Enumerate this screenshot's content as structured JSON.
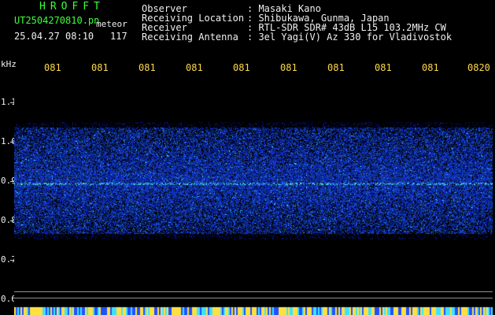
{
  "header": {
    "app_title": "HROFFT",
    "file_name": "UT2504270810.pn",
    "file_tag": "meteor",
    "date_time": "25.04.27 08:10",
    "count": "117"
  },
  "info": [
    {
      "label": "Observer",
      "value": ": Masaki Kano"
    },
    {
      "label": "Receiving Location",
      "value": ": Shibukawa, Gunma, Japan"
    },
    {
      "label": "Receiver",
      "value": ": RTL-SDR SDR# 43dB L15 103.2MHz CW"
    },
    {
      "label": "Receiving Antenna",
      "value": ": 3el Yagi(V) Az 330 for Vladivostok"
    }
  ],
  "axis": {
    "y_unit": "kHz",
    "y_ticks": [
      "1.1",
      "1.0",
      "0.9",
      "0.8",
      "0.7",
      "0.6"
    ],
    "x_ticks": [
      "081",
      "081",
      "081",
      "081",
      "081",
      "081",
      "081",
      "081",
      "081",
      "0820"
    ]
  },
  "colors": {
    "text_green": "#3cff3c",
    "text_white": "#f0f0f0",
    "text_yellow": "#ffd94a",
    "signal_blue": "#2a3cff",
    "signal_cyan": "#40e0ff"
  }
}
